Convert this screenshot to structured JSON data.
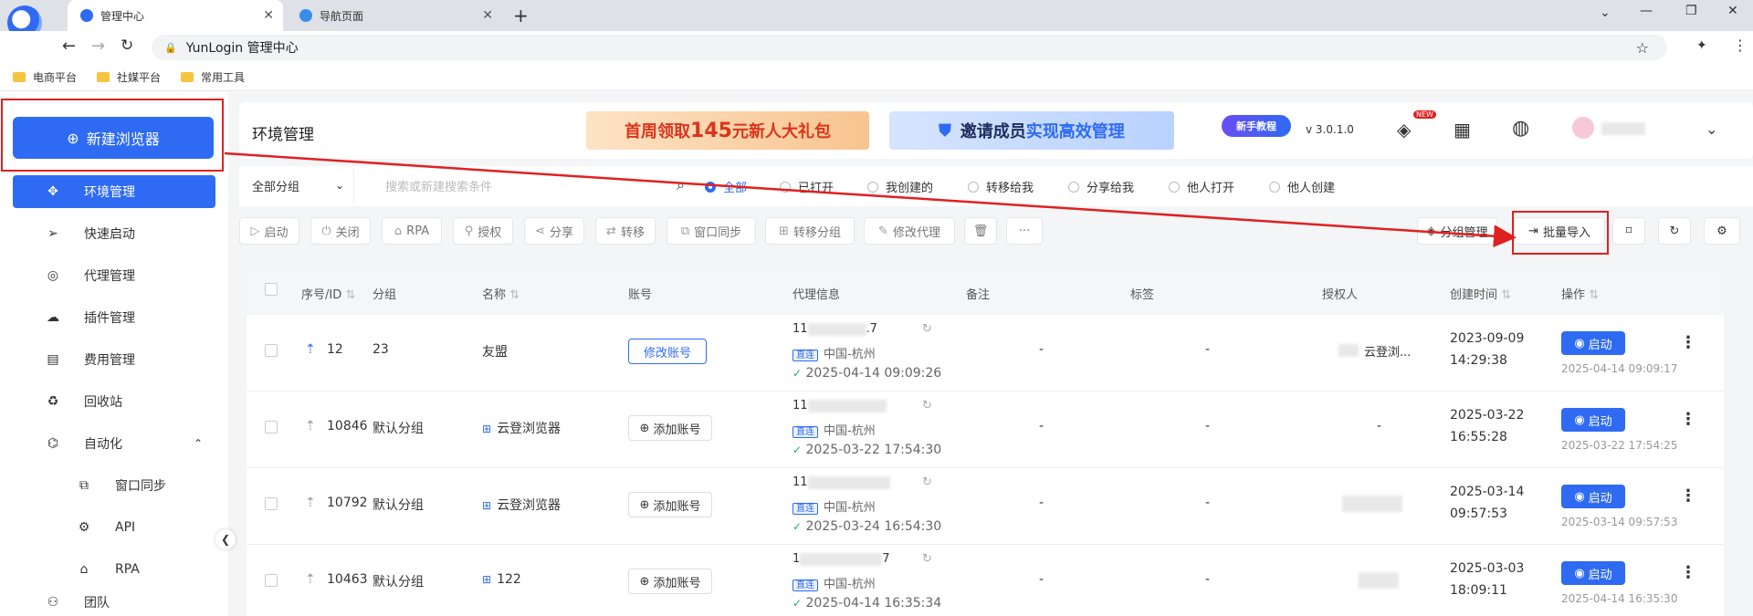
{
  "browser": {
    "tabs": [
      {
        "label": "管理中心",
        "active": true
      },
      {
        "label": "导航页面",
        "active": false
      }
    ],
    "url": "YunLogin 管理中心",
    "bookmarks": [
      "电商平台",
      "社媒平台",
      "常用工具"
    ]
  },
  "sidebar": {
    "new_browser": "新建浏览器",
    "items": [
      {
        "label": "环境管理",
        "icon": "environment-icon",
        "active": true
      },
      {
        "label": "快速启动",
        "icon": "send-icon"
      },
      {
        "label": "代理管理",
        "icon": "globe-icon"
      },
      {
        "label": "插件管理",
        "icon": "plugin-icon"
      },
      {
        "label": "费用管理",
        "icon": "billing-icon"
      },
      {
        "label": "回收站",
        "icon": "recycle-icon"
      },
      {
        "label": "自动化",
        "icon": "automation-icon",
        "expanded": true
      },
      {
        "label": "窗口同步",
        "icon": "window-sync-icon",
        "sub": true
      },
      {
        "label": "API",
        "icon": "api-icon",
        "sub": true
      },
      {
        "label": "RPA",
        "icon": "robot-icon",
        "sub": true
      },
      {
        "label": "团队",
        "icon": "team-icon"
      }
    ]
  },
  "header": {
    "title": "环境管理",
    "banner1": {
      "prefix": "首周领取",
      "amount": "145",
      "suffix": "元新人大礼包"
    },
    "banner2": {
      "prefix": "邀请成员",
      "highlight": "实现高效管理"
    },
    "tutorial": "新手教程",
    "version": "v 3.0.1.0",
    "new_badge": "NEW"
  },
  "filters": {
    "group_select": "全部分组",
    "search_placeholder": "搜索或新建搜索条件",
    "radios": [
      {
        "label": "全部",
        "on": true
      },
      {
        "label": "已打开"
      },
      {
        "label": "我创建的"
      },
      {
        "label": "转移给我"
      },
      {
        "label": "分享给我"
      },
      {
        "label": "他人打开"
      },
      {
        "label": "他人创建"
      }
    ]
  },
  "actions": {
    "start": "启动",
    "close": "关闭",
    "rpa": "RPA",
    "authorize": "授权",
    "share": "分享",
    "transfer": "转移",
    "window_sync": "窗口同步",
    "transfer_group": "转移分组",
    "modify_proxy": "修改代理",
    "more": "···",
    "group_manage": "分组管理",
    "batch_import": "批量导入"
  },
  "table": {
    "headers": [
      "序号/ID",
      "分组",
      "名称",
      "账号",
      "代理信息",
      "备注",
      "标签",
      "授权人",
      "创建时间",
      "操作"
    ],
    "rows": [
      {
        "id": "12",
        "group": "23",
        "name": "友盟",
        "name_icon": false,
        "account_btn": "修改账号",
        "account_blue": true,
        "proxy_ip": "11",
        "proxy_tail": ".7",
        "proxy_tag": "直连",
        "proxy_loc": "中国-杭州",
        "proxy_time": "2025-04-14 09:09:26",
        "note": "-",
        "label": "-",
        "authorizer": "云登浏...",
        "created_date": "2023-09-09",
        "created_time": "14:29:38",
        "start": "启动",
        "last_start": "2025-04-14 09:09:17"
      },
      {
        "id": "10846",
        "group": "默认分组",
        "name": "云登浏览器",
        "name_icon": true,
        "account_btn": "添加账号",
        "account_blue": false,
        "proxy_ip": "11",
        "proxy_tail": "",
        "proxy_tag": "直连",
        "proxy_loc": "中国-杭州",
        "proxy_time": "2025-03-22 17:54:30",
        "note": "-",
        "label": "-",
        "authorizer": "-",
        "created_date": "2025-03-22",
        "created_time": "16:55:28",
        "start": "启动",
        "last_start": "2025-03-22 17:54:25"
      },
      {
        "id": "10792",
        "group": "默认分组",
        "name": "云登浏览器",
        "name_icon": true,
        "account_btn": "添加账号",
        "account_blue": false,
        "proxy_ip": "11",
        "proxy_tail": "",
        "proxy_tag": "直连",
        "proxy_loc": "中国-杭州",
        "proxy_time": "2025-03-24 16:54:30",
        "note": "-",
        "label": "-",
        "authorizer": "",
        "created_date": "2025-03-14",
        "created_time": "09:57:53",
        "start": "启动",
        "last_start": "2025-03-14 09:57:53"
      },
      {
        "id": "10463",
        "group": "默认分组",
        "name": "122",
        "name_icon": true,
        "account_btn": "添加账号",
        "account_blue": false,
        "proxy_ip": "1",
        "proxy_tail": "7",
        "proxy_tag": "直连",
        "proxy_loc": "中国-杭州",
        "proxy_time": "2025-04-14 16:35:34",
        "note": "-",
        "label": "-",
        "authorizer": "",
        "created_date": "2025-03-03",
        "created_time": "18:09:11",
        "start": "启动",
        "last_start": "2025-04-14 16:35:30"
      }
    ]
  },
  "colors": {
    "primary": "#2f6bf2",
    "annotation": "#e02020"
  }
}
